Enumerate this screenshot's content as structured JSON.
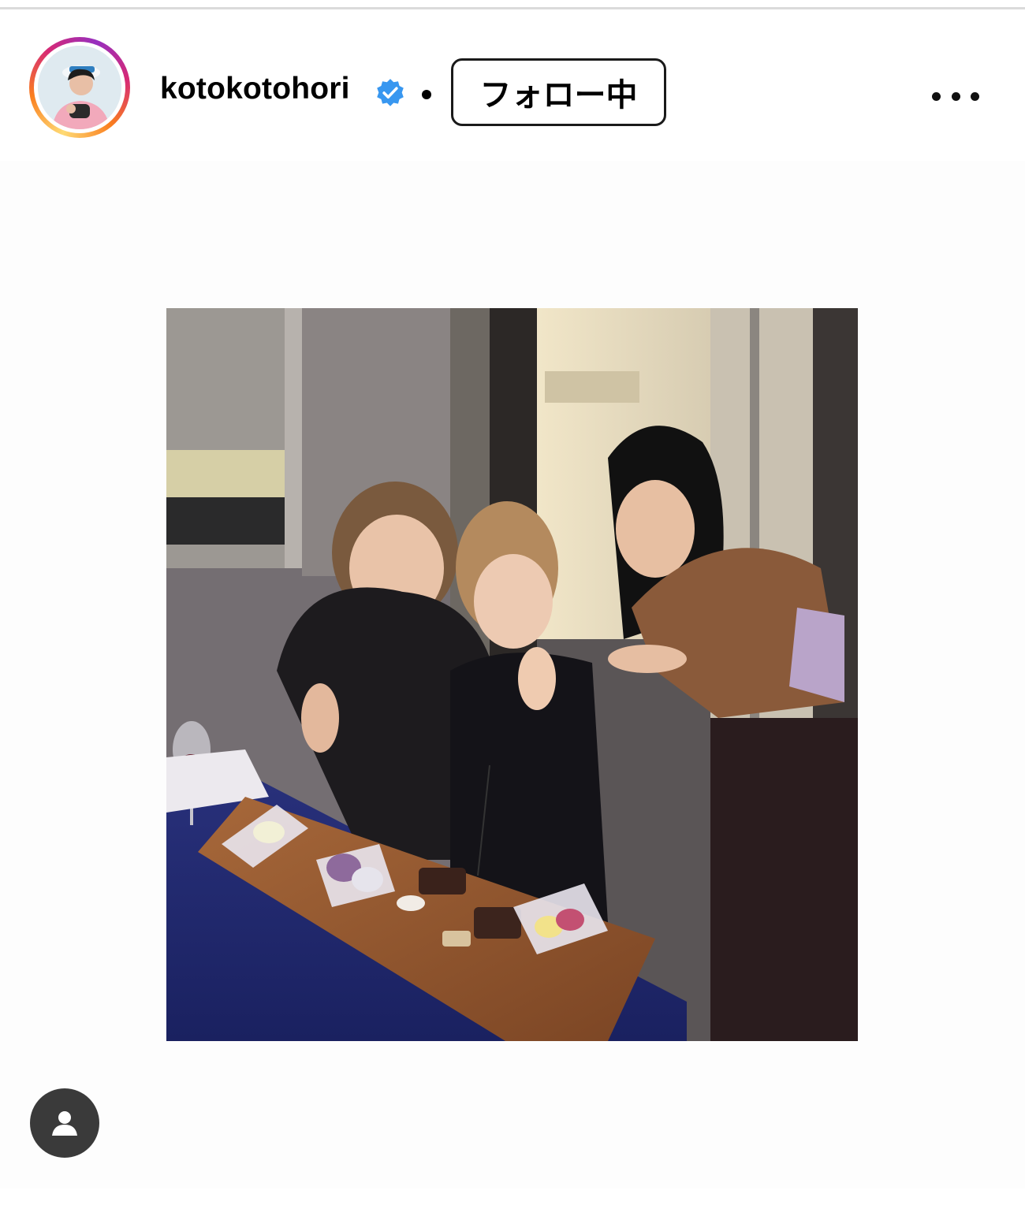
{
  "post": {
    "username": "kotokotohori",
    "verified": true,
    "separator": "•",
    "follow_label": "フォロー中",
    "more_icon": "more-horizontal-icon",
    "media_type": "photo",
    "tagged_users_icon": "user-tag-icon"
  },
  "colors": {
    "verified_blue": "#3897f0",
    "button_border": "#1a1a1a",
    "badge_bg": "#3a3a3a"
  }
}
